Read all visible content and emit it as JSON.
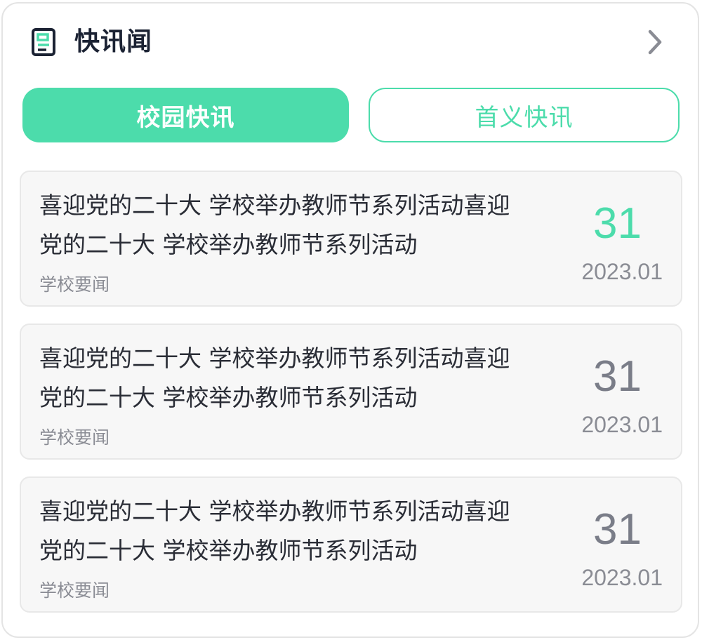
{
  "header": {
    "title": "快讯闻",
    "icon": "news-document-icon",
    "more_icon": "chevron-right-icon"
  },
  "tabs": [
    {
      "label": "校园快讯",
      "active": true
    },
    {
      "label": "首义快讯",
      "active": false
    }
  ],
  "news": [
    {
      "title": "喜迎党的二十大 学校举办教师节系列活动喜迎党的二十大 学校举办教师节系列活动",
      "tag": "学校要闻",
      "day": "31",
      "month": "2023.01",
      "highlight": true
    },
    {
      "title": "喜迎党的二十大 学校举办教师节系列活动喜迎党的二十大 学校举办教师节系列活动",
      "tag": "学校要闻",
      "day": "31",
      "month": "2023.01",
      "highlight": false
    },
    {
      "title": "喜迎党的二十大 学校举办教师节系列活动喜迎党的二十大 学校举办教师节系列活动",
      "tag": "学校要闻",
      "day": "31",
      "month": "2023.01",
      "highlight": false
    }
  ],
  "colors": {
    "accent": "#4cdcab",
    "day_default": "#7a7d88",
    "title": "#1b2233"
  }
}
